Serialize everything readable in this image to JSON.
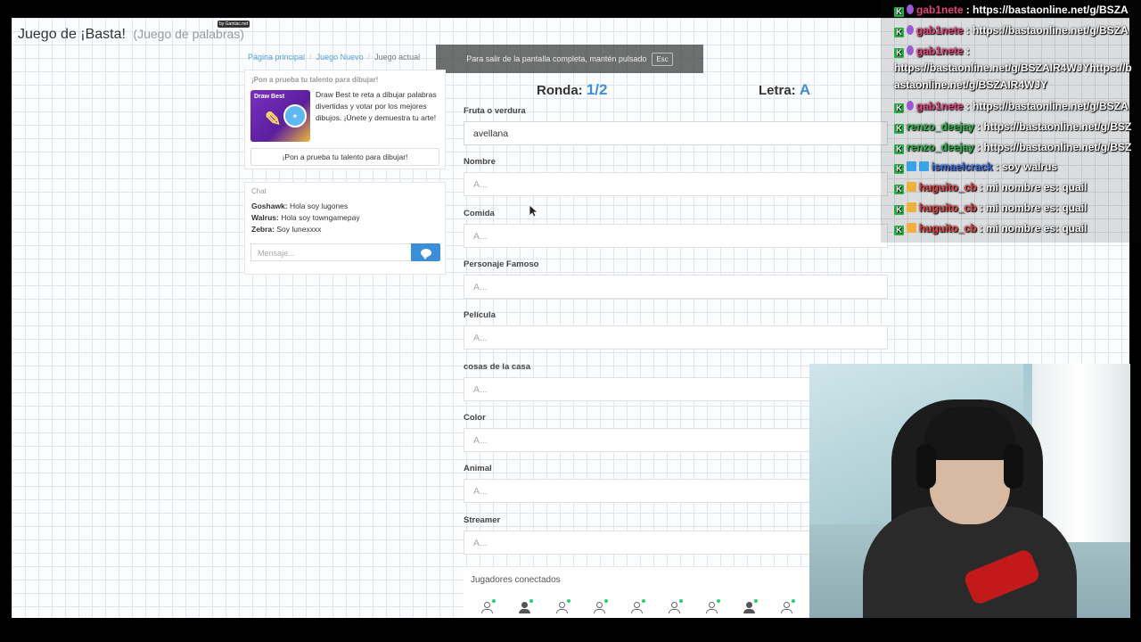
{
  "site": {
    "title": "Juego de ¡Basta!",
    "subtitle": "(Juego de palabras)",
    "byline": "by Gamiac.net"
  },
  "breadcrumb": [
    "Página principal",
    "Juego Nuevo",
    "Juego actual"
  ],
  "fullscreen_notice": {
    "text": "Para salir de la pantalla completa, mantén pulsado",
    "key": "Esc"
  },
  "promo": {
    "heading": "¡Pon a prueba tu talento para dibujar!",
    "image_title": "Draw Best",
    "text": "Draw Best te reta a dibujar palabras divertidas y votar por los mejores dibujos. ¡Únete y demuestra tu arte!",
    "button": "¡Pon a prueba tu talento para dibujar!"
  },
  "chat": {
    "title": "Chat",
    "messages": [
      {
        "user": "Goshawk:",
        "text": "Hola soy lugones"
      },
      {
        "user": "Walrus:",
        "text": "Hola soy towngamepay"
      },
      {
        "user": "Zebra:",
        "text": "Soy lunexxxx"
      }
    ],
    "placeholder": "Mensaje..."
  },
  "game": {
    "round_label": "Ronda:",
    "round_value": "1/2",
    "letter_label": "Letra:",
    "letter_value": "A",
    "fields": [
      {
        "label": "Fruta o verdura",
        "value": "avellana"
      },
      {
        "label": "Nombre",
        "value": "A..."
      },
      {
        "label": "Comida",
        "value": "A..."
      },
      {
        "label": "Personaje Famoso",
        "value": "A..."
      },
      {
        "label": "Película",
        "value": "A..."
      },
      {
        "label": "cosas de la casa",
        "value": "A..."
      },
      {
        "label": "Color",
        "value": "A..."
      },
      {
        "label": "Animal",
        "value": "A..."
      },
      {
        "label": "Streamer",
        "value": "A..."
      }
    ]
  },
  "players": {
    "title": "Jugadores conectados",
    "count": 9
  },
  "stream_chat": {
    "lines": [
      {
        "name": "gab1nete",
        "name_color": "#e0457b",
        "text": ": https://bastaonline.net/g/BSZA"
      },
      {
        "name": "gab1nete",
        "name_color": "#e0457b",
        "text": ": https://bastaonline.net/g/BSZA"
      },
      {
        "name": "gab1nete",
        "name_color": "#e0457b",
        "text": ":"
      },
      {
        "name": "gab1nete",
        "name_color": "#e0457b",
        "text": ": https://bastaonline.net/g/BSZA"
      },
      {
        "name": "renzo_deejay",
        "name_color": "#2bb34a",
        "text": ": https://bastaonline.net/g/BSZ"
      },
      {
        "name": "renzo_deejay",
        "name_color": "#2bb34a",
        "text": ": https://bastaonline.net/g/BSZ"
      },
      {
        "name": "ismaelcrack",
        "name_color": "#3a6fe8",
        "text": ": soy walrus"
      },
      {
        "name": "huguito_cb",
        "name_color": "#e04040",
        "text": ": mi nombre es: quail"
      },
      {
        "name": "huguito_cb",
        "name_color": "#e04040",
        "text": ": mi nombre es: quail"
      },
      {
        "name": "huguito_cb",
        "name_color": "#e04040",
        "text": ": mi nombre es: quail"
      }
    ],
    "wrapped_text": "https://bastaonline.net/g/BSZAIR4WJYhttps://bastaonline.net/g/BSZAIR4WJY"
  }
}
